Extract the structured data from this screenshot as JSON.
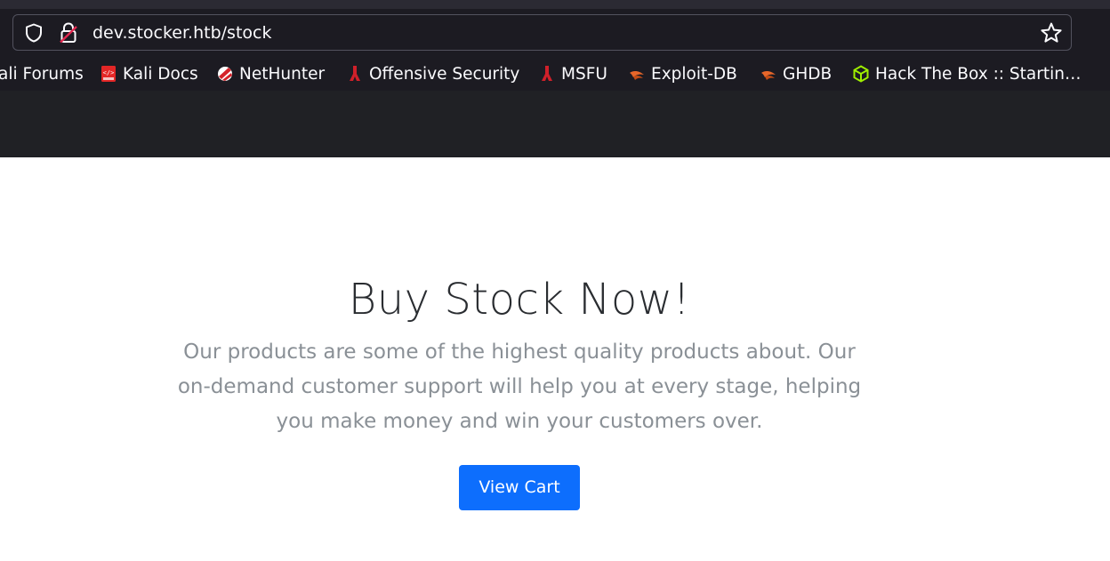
{
  "address_bar": {
    "url": "dev.stocker.htb/stock"
  },
  "bookmarks": [
    {
      "label": "ali Forums",
      "icon": "kali-forums-icon"
    },
    {
      "label": "Kali Docs",
      "icon": "kali-docs-icon"
    },
    {
      "label": "NetHunter",
      "icon": "nethunter-icon"
    },
    {
      "label": "Offensive Security",
      "icon": "offensive-security-icon"
    },
    {
      "label": "MSFU",
      "icon": "msfu-icon"
    },
    {
      "label": "Exploit-DB",
      "icon": "exploit-db-icon"
    },
    {
      "label": "GHDB",
      "icon": "ghdb-icon"
    },
    {
      "label": "Hack The Box :: Startin…",
      "icon": "hack-the-box-icon"
    }
  ],
  "hero": {
    "title": "Buy Stock Now!",
    "text": "Our products are some of the highest quality products about. Our on-demand customer support will help you at every stage, helping you make money and win your customers over.",
    "button_label": "View Cart"
  },
  "colors": {
    "chrome_bg": "#1c1b22",
    "toolbar_strip": "#202125",
    "button_primary": "#0d6efd",
    "title_text": "#2a2d31",
    "muted_text": "#8a9096"
  }
}
